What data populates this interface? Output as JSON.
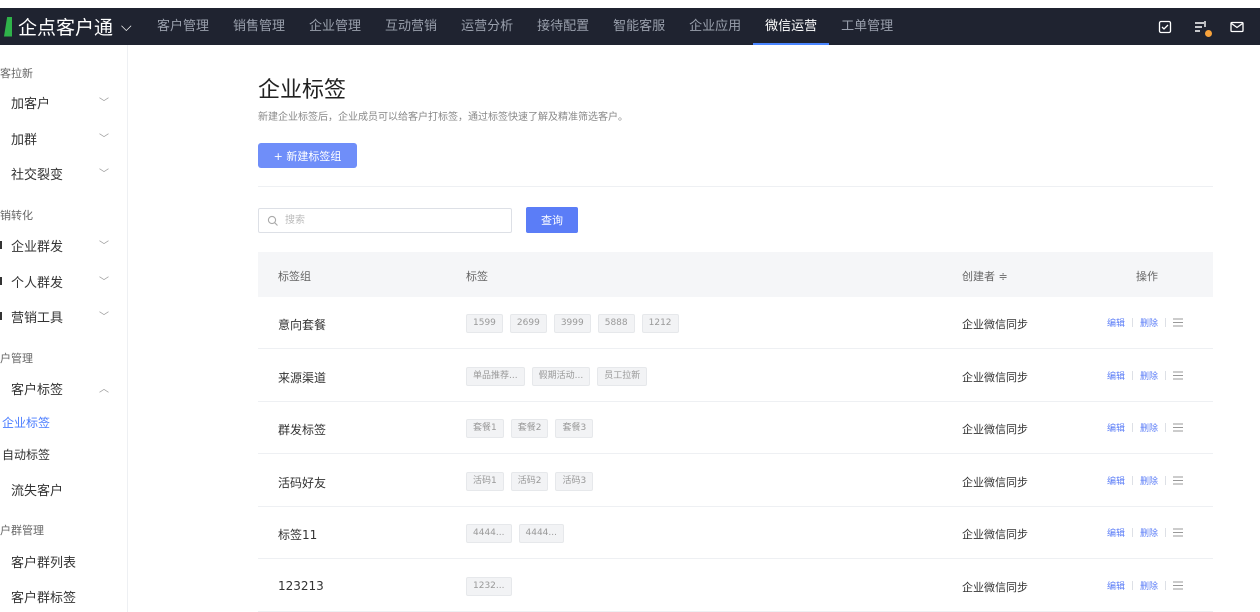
{
  "app": {
    "name": "企点客户通"
  },
  "nav": {
    "items": [
      "客户管理",
      "销售管理",
      "企业管理",
      "互动营销",
      "运营分析",
      "接待配置",
      "智能客服",
      "企业应用",
      "微信运营",
      "工单管理"
    ],
    "active_index": 8
  },
  "sidebar": {
    "group1": "客拉新",
    "item_jia_kehu": "加客户",
    "item_jiaqun": "加群",
    "item_shejiao": "社交裂变",
    "group2": "销转化",
    "item_qiye_qunfa": "企业群发",
    "item_geren_qunfa": "个人群发",
    "item_yingxiao": "营销工具",
    "group3": "户管理",
    "item_kehu_biaoqian": "客户标签",
    "sub_qiye_biaoqian": "企业标签",
    "sub_zidong_biaoqian": "自动标签",
    "item_liushi": "流失客户",
    "group4": "户群管理",
    "item_kehuqun_list": "客户群列表",
    "item_kehuqun_tag": "客户群标签"
  },
  "page": {
    "title": "企业标签",
    "subtitle": "新建企业标签后，企业成员可以给客户打标签，通过标签快速了解及精准筛选客户。",
    "new_button": "+ 新建标签组"
  },
  "search": {
    "placeholder": "搜索",
    "value": "",
    "button": "查询"
  },
  "table": {
    "headers": {
      "group": "标签组",
      "tags": "标签",
      "creator": "创建者 ≑",
      "ops": "操作"
    },
    "ops": {
      "edit": "编辑",
      "delete": "删除"
    },
    "rows": [
      {
        "group": "意向套餐",
        "tags": [
          "1599",
          "2699",
          "3999",
          "5888",
          "1212"
        ],
        "creator": "企业微信同步"
      },
      {
        "group": "来源渠道",
        "tags": [
          "单品推荐...",
          "假期活动...",
          "员工拉新"
        ],
        "creator": "企业微信同步"
      },
      {
        "group": "群发标签",
        "tags": [
          "套餐1",
          "套餐2",
          "套餐3"
        ],
        "creator": "企业微信同步"
      },
      {
        "group": "活码好友",
        "tags": [
          "活码1",
          "活码2",
          "活码3"
        ],
        "creator": "企业微信同步"
      },
      {
        "group": "标签11",
        "tags": [
          "4444...",
          "4444..."
        ],
        "creator": "企业微信同步"
      },
      {
        "group": "123213",
        "tags": [
          "1232..."
        ],
        "creator": "企业微信同步"
      }
    ]
  },
  "colors": {
    "topbar": "#1f2330",
    "accent": "#5b7df7",
    "brand_green": "#2fb34a"
  }
}
